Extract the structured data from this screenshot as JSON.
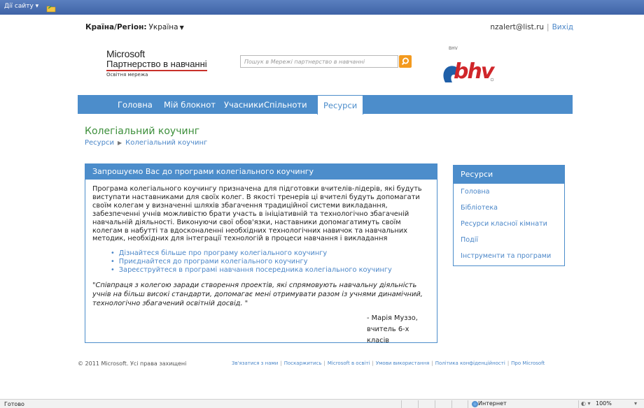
{
  "ribbon": {
    "site_actions": "Дії сайту ▾"
  },
  "header": {
    "region_label": "Країна/Регіон:",
    "region_value": "Україна",
    "user_email": "nzalert@list.ru",
    "separator": "|",
    "logout": "Вихід"
  },
  "logo": {
    "microsoft": "Microsoft",
    "program": "Партнерство в навчанні",
    "network": "Освітня мережа"
  },
  "search": {
    "placeholder": "Пошук в Мережі партнерство в навчанні"
  },
  "bhv": {
    "small": "BHV",
    "brand": "bhv"
  },
  "nav": {
    "items": [
      "Головна",
      "Мій блокнот",
      "Учасники",
      "Спільноти",
      "Ресурси"
    ],
    "active_index": 4
  },
  "page": {
    "title": "Колегіальний коучинг",
    "breadcrumb_root": "Ресурси",
    "breadcrumb_arrow": "▶",
    "breadcrumb_current": "Колегіальний коучинг"
  },
  "main_panel": {
    "heading": "Запрошуємо Вас до програми колегіального коучингу",
    "paragraph": "Програма колегіального коучингу призначена для підготовки вчителів-лідерів, які будуть виступати наставниками для своїх колег. В якості тренерів ці вчителі будуть допомагати своїм колегам у визначенні шляхів збагачення традиційної системи викладання, забезпеченні учнів можливістю брати участь в ініціативній та технологічно збагаченій навчальній діяльності. Виконуючи свої обов'язки, наставники допомагатимуть своїм колегам в набутті та вдосконаленні необхідних технологічних навичок та навчальних методик, необхідних для інтеграції технологій в процеси навчання і викладання",
    "links": [
      "Дізнайтеся більше про програму колегіального коучингу",
      "Приєднайтеся до програми колегіального коучингу",
      "Зареєструйтеся в програмі навчання посередника колегіального коучингу"
    ],
    "quote": "\"Співпраця з колегою заради створення проектів, які спрямовують навчальну діяльність учнів на більш високі стандарти, допомагає мені отримувати разом із учнями динамічний, технологічно збагачений освітній досвід. \"",
    "author_name": "- Марія Муззо,",
    "author_role": "вчитель 6-х класів"
  },
  "side_panel": {
    "heading": "Ресурси",
    "links": [
      "Головна",
      "Бібліотека",
      "Ресурси класної кімнати",
      "Події",
      "Інструменти та програми"
    ]
  },
  "footer": {
    "copyright": "© 2011 Microsoft. Усі права захищені",
    "links": [
      "Зв'язатися з нами",
      "Поскаржитись",
      "Microsoft в освіті",
      "Умови використання",
      "Політика конфіденційності",
      "Про Microsoft"
    ]
  },
  "statusbar": {
    "status": "Готово",
    "zone": "Интернет",
    "zoom": "100%"
  },
  "colors": {
    "accent": "#4c8dcb",
    "title_green": "#3d8f3b",
    "search_button": "#f39a1f",
    "bhv_red": "#d0262a",
    "bhv_blue": "#1f5fa8"
  }
}
